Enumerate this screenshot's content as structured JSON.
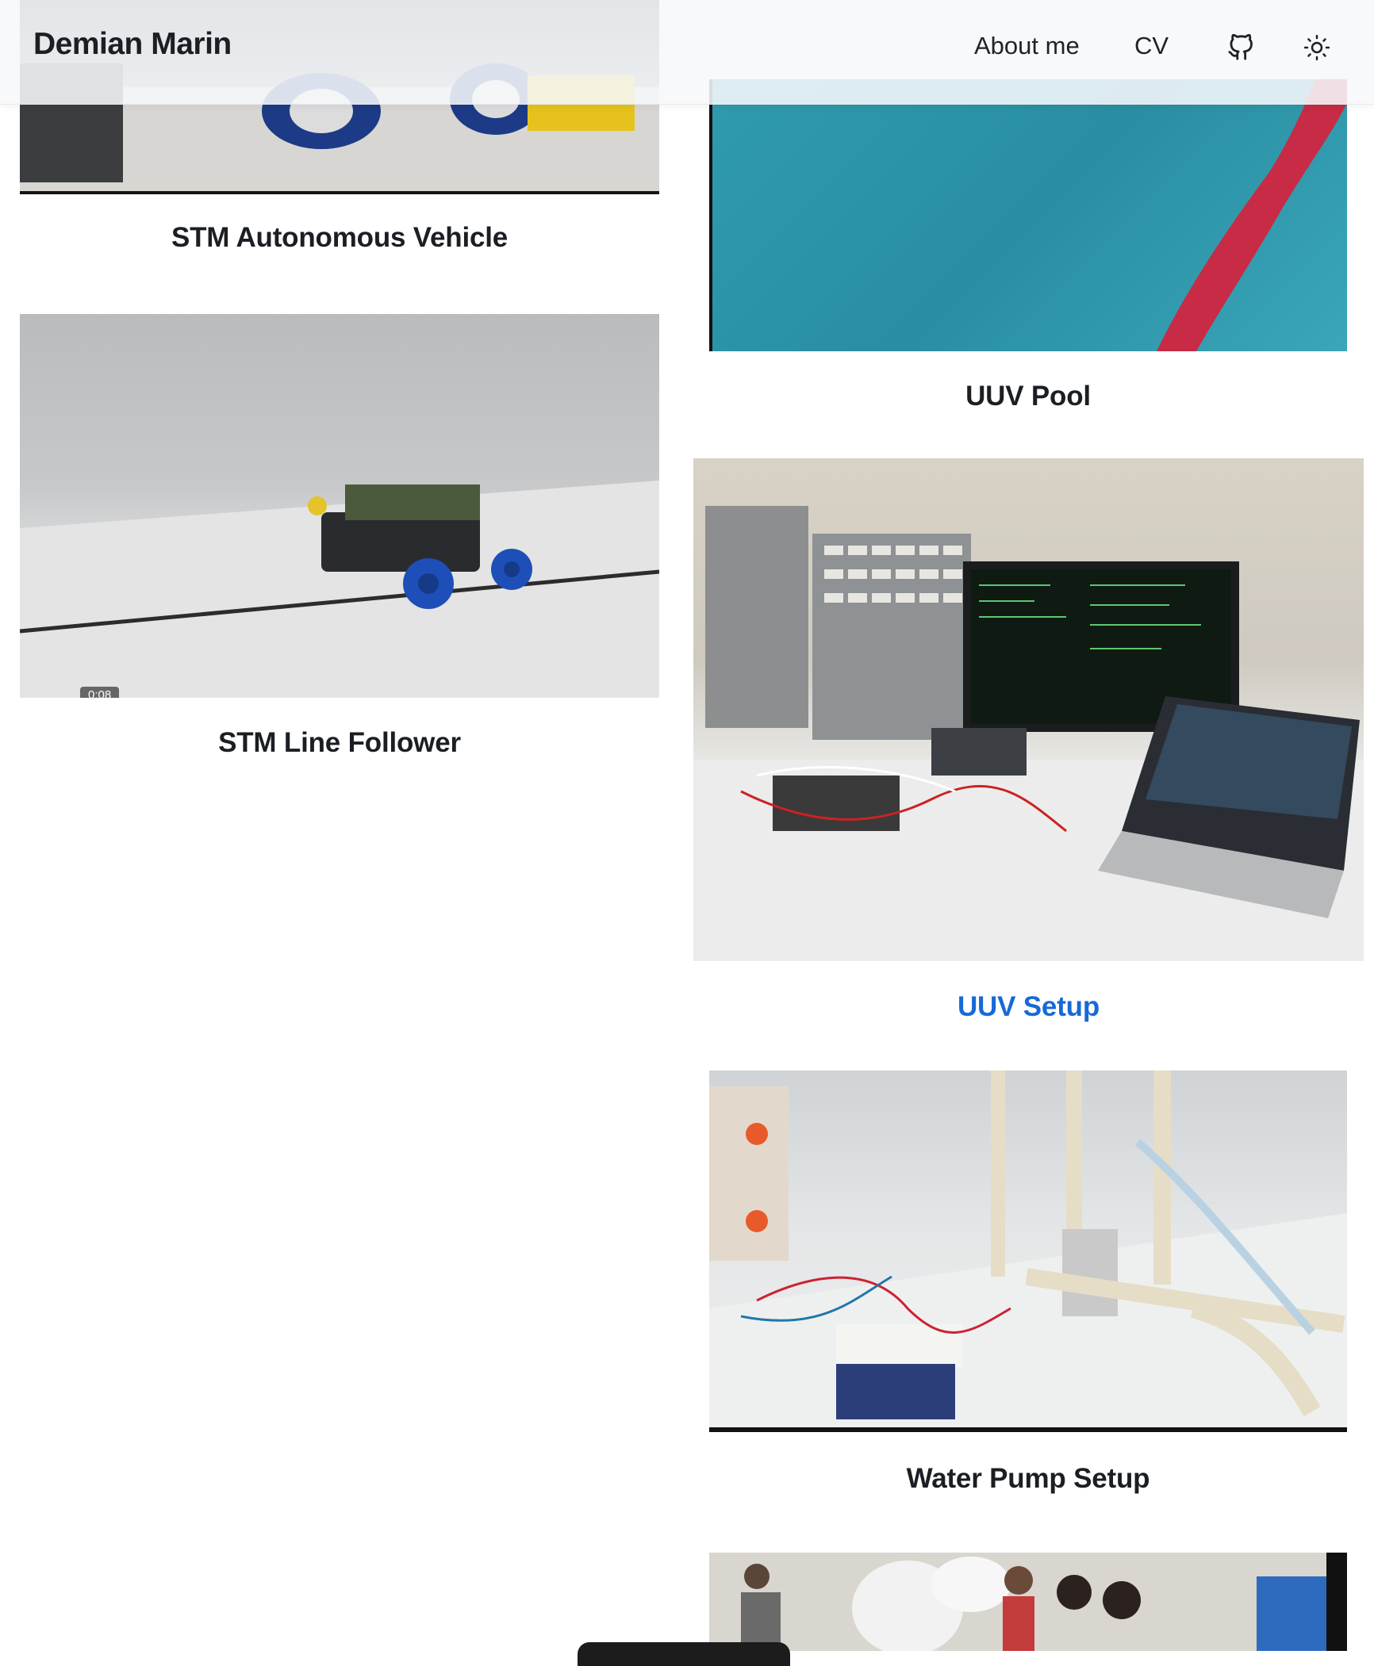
{
  "header": {
    "brand": "Demian Marin",
    "nav": {
      "about_label": "About me",
      "cv_label": "CV"
    },
    "icons": {
      "github": "github-icon",
      "theme": "sun-icon"
    }
  },
  "projects": {
    "vehicle": {
      "title": "STM Autonomous Vehicle"
    },
    "line_follower": {
      "title": "STM Line Follower",
      "video_time": "0:08"
    },
    "pool": {
      "title": "UUV Pool"
    },
    "setup": {
      "title": "UUV Setup"
    },
    "pump": {
      "title": "Water Pump Setup"
    }
  },
  "colors": {
    "link": "#1769d6",
    "text": "#1b1f24"
  }
}
